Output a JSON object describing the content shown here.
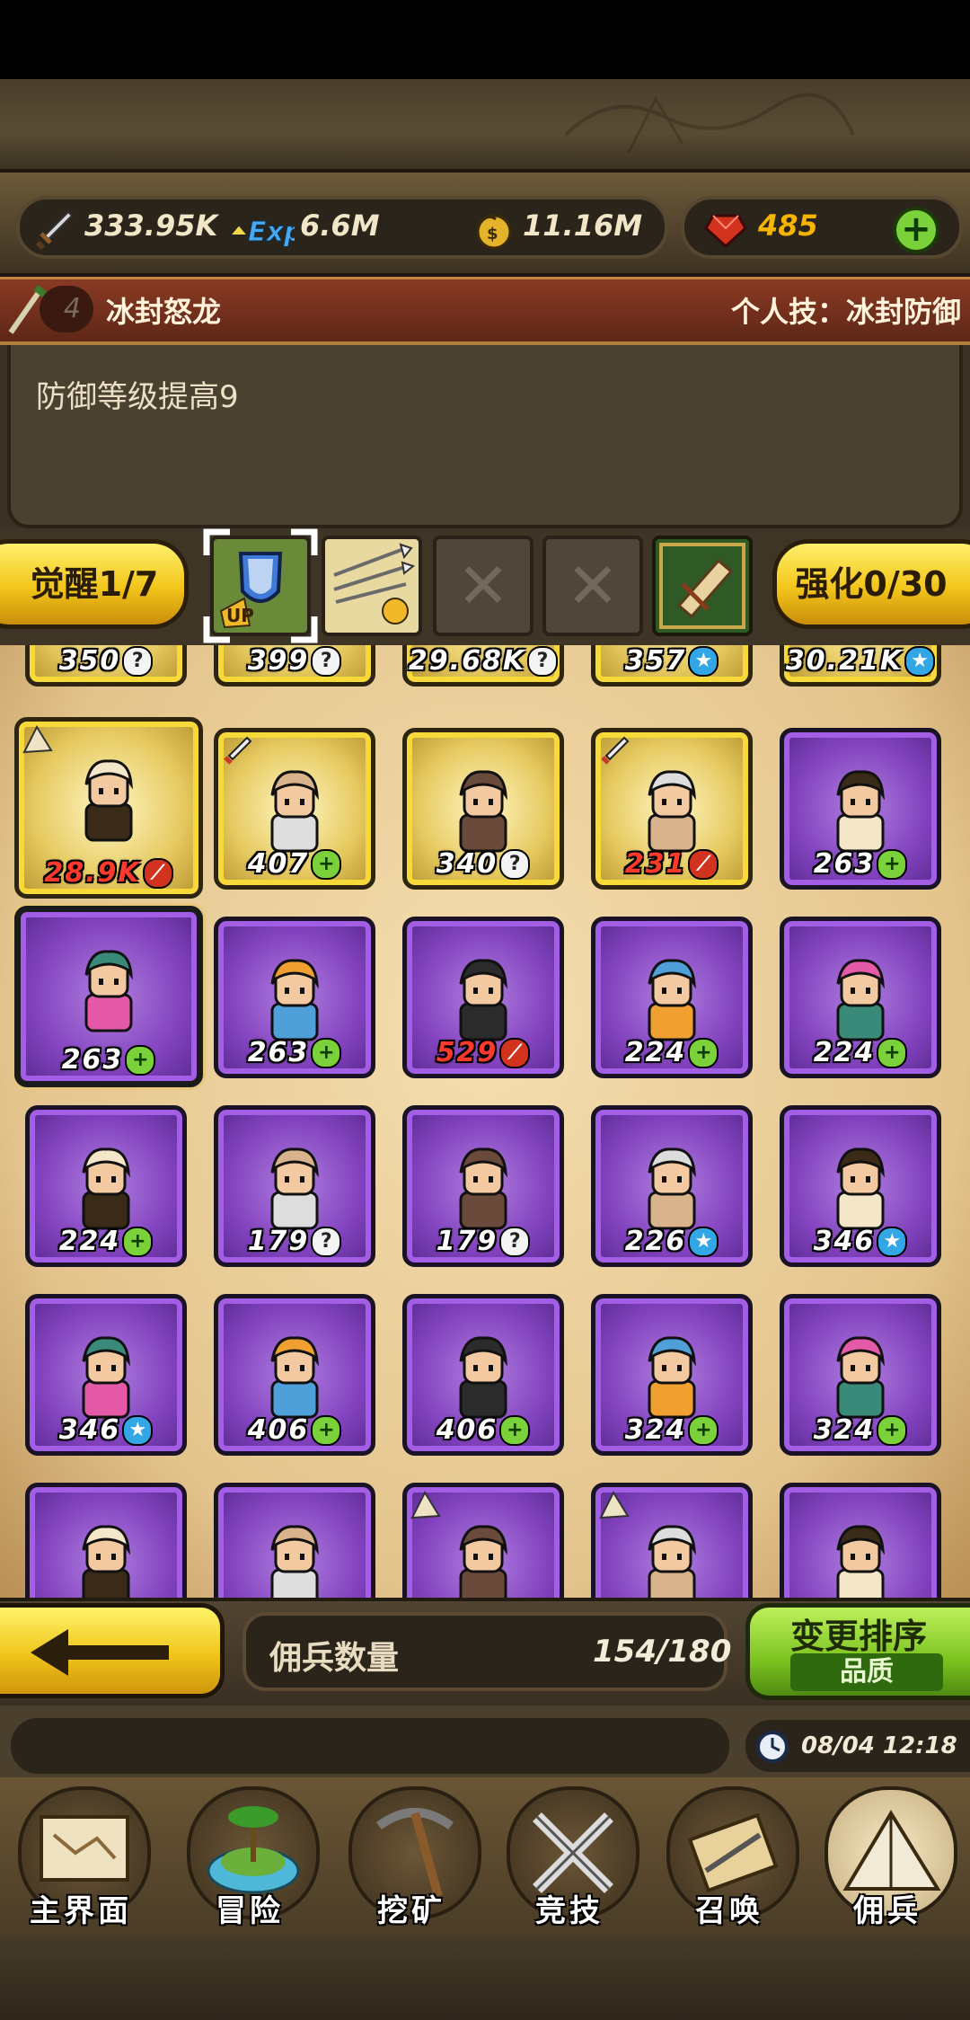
{
  "resources": {
    "attack": "333.95K",
    "exp": "6.6M",
    "gold": "11.16M",
    "gems": "485"
  },
  "skill": {
    "level": "4",
    "name": "冰封怒龙",
    "personal_skill": "个人技：冰封防御",
    "description": "防御等级提高9"
  },
  "awaken": {
    "awaken_label": "觉醒1/7",
    "enhance_label": "强化0/30"
  },
  "partial_row": [
    {
      "value": "350",
      "badge": "?"
    },
    {
      "value": "399",
      "badge": "?"
    },
    {
      "value": "29.68K",
      "badge": "?"
    },
    {
      "value": "357",
      "badge": "★"
    },
    {
      "value": "30.21K",
      "badge": "★"
    }
  ],
  "mercenaries": [
    {
      "value": "28.9K",
      "badge": "red",
      "rarity": "gold",
      "tag": "tent"
    },
    {
      "value": "407",
      "badge": "+",
      "rarity": "gold",
      "tag": "sword"
    },
    {
      "value": "340",
      "badge": "?",
      "rarity": "gold",
      "tag": ""
    },
    {
      "value": "231",
      "badge": "red",
      "rarity": "gold",
      "tag": "sword"
    },
    {
      "value": "263",
      "badge": "+",
      "rarity": "purple",
      "tag": ""
    },
    {
      "value": "263",
      "badge": "+",
      "rarity": "purple",
      "tag": "",
      "selected": true
    },
    {
      "value": "263",
      "badge": "+",
      "rarity": "purple",
      "tag": ""
    },
    {
      "value": "529",
      "badge": "red",
      "rarity": "purple",
      "tag": ""
    },
    {
      "value": "224",
      "badge": "+",
      "rarity": "purple",
      "tag": ""
    },
    {
      "value": "224",
      "badge": "+",
      "rarity": "purple",
      "tag": ""
    },
    {
      "value": "224",
      "badge": "+",
      "rarity": "purple",
      "tag": ""
    },
    {
      "value": "179",
      "badge": "?",
      "rarity": "purple",
      "tag": ""
    },
    {
      "value": "179",
      "badge": "?",
      "rarity": "purple",
      "tag": ""
    },
    {
      "value": "226",
      "badge": "★",
      "rarity": "purple",
      "tag": ""
    },
    {
      "value": "346",
      "badge": "★",
      "rarity": "purple",
      "tag": ""
    },
    {
      "value": "346",
      "badge": "★",
      "rarity": "purple",
      "tag": ""
    },
    {
      "value": "406",
      "badge": "+",
      "rarity": "purple",
      "tag": ""
    },
    {
      "value": "406",
      "badge": "+",
      "rarity": "purple",
      "tag": ""
    },
    {
      "value": "324",
      "badge": "+",
      "rarity": "purple",
      "tag": ""
    },
    {
      "value": "324",
      "badge": "+",
      "rarity": "purple",
      "tag": ""
    },
    {
      "value": "",
      "badge": "",
      "rarity": "purple",
      "tag": ""
    },
    {
      "value": "",
      "badge": "",
      "rarity": "purple",
      "tag": ""
    },
    {
      "value": "",
      "badge": "",
      "rarity": "purple",
      "tag": "tent"
    },
    {
      "value": "",
      "badge": "",
      "rarity": "purple",
      "tag": "tent"
    },
    {
      "value": "",
      "badge": "",
      "rarity": "purple",
      "tag": ""
    }
  ],
  "footer": {
    "count_label": "佣兵数量",
    "count_value": "154/180",
    "sort_label": "变更排序",
    "sort_mode": "品质",
    "datetime": "08/04 12:18"
  },
  "nav": [
    {
      "label": "主界面",
      "icon": "scroll-map-icon"
    },
    {
      "label": "冒险",
      "icon": "island-icon"
    },
    {
      "label": "挖矿",
      "icon": "pickaxe-icon"
    },
    {
      "label": "竞技",
      "icon": "crossed-swords-icon"
    },
    {
      "label": "召唤",
      "icon": "summon-scroll-icon"
    },
    {
      "label": "佣兵",
      "icon": "tent-icon"
    }
  ],
  "colors": {
    "gold_card": "#f7d93a",
    "purple_card": "#a25ee4",
    "accent_green": "#7cc321",
    "gem_red": "#d2331f"
  }
}
